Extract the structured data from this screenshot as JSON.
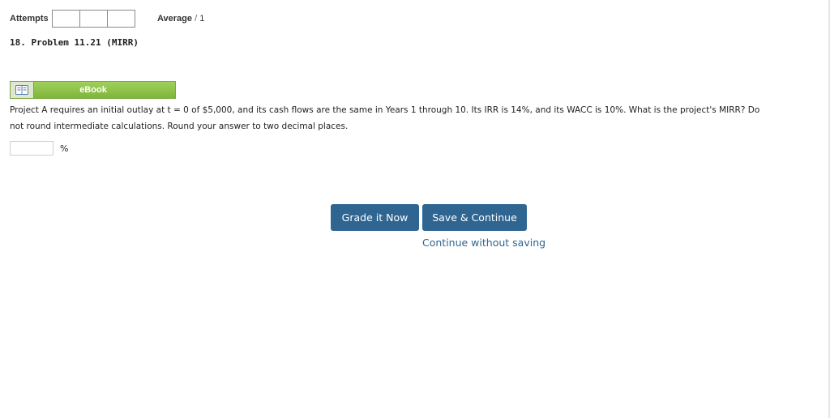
{
  "attempts": {
    "label": "Attempts",
    "boxes": [
      "",
      "",
      ""
    ]
  },
  "average": {
    "label": "Average",
    "separator": "/",
    "max": "1"
  },
  "problem": {
    "title": "18. Problem 11.21 (MIRR)",
    "question_line1": "Project A requires an initial outlay at t = 0 of $5,000, and its cash flows are the same in Years 1 through 10. Its IRR is 14%, and its WACC is 10%. What is the project's MIRR? Do",
    "question_line2": "not round intermediate calculations. Round your answer to two decimal places."
  },
  "ebook": {
    "label": "eBook",
    "icon": "book-icon"
  },
  "answer": {
    "value": "",
    "placeholder": "",
    "unit": "%"
  },
  "actions": {
    "grade_label": "Grade it Now",
    "save_label": "Save & Continue",
    "continue_label": "Continue without saving"
  },
  "colors": {
    "primary_button": "#2f6591",
    "ebook_green": "#8dc448",
    "link": "#2f6591"
  }
}
